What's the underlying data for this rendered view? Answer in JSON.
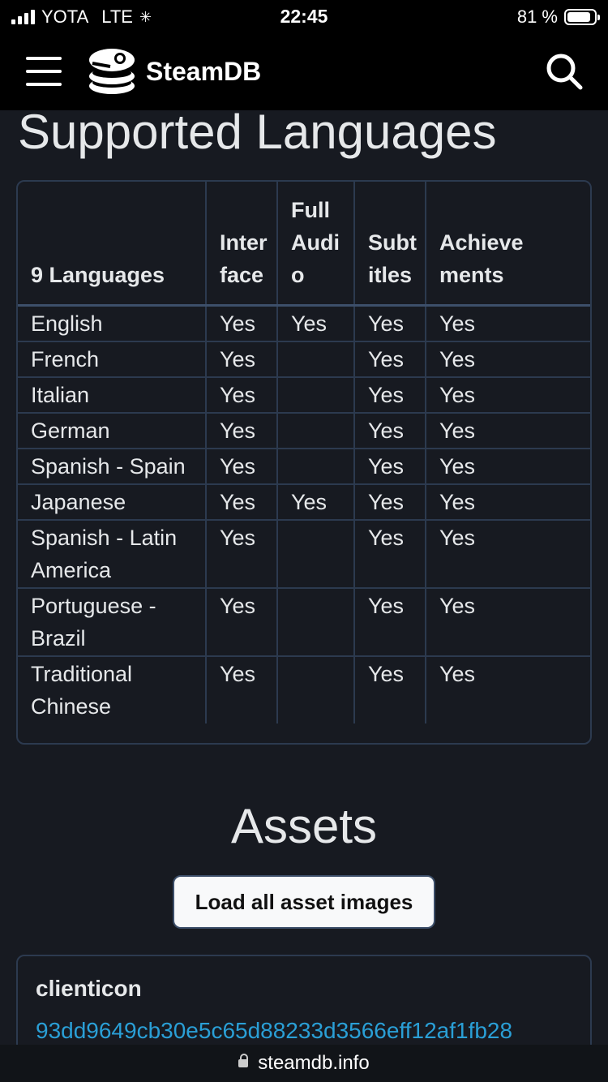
{
  "status_bar": {
    "carrier": "YOTA",
    "network": "LTE",
    "time": "22:45",
    "battery": "81 %"
  },
  "navbar": {
    "brand": "SteamDB"
  },
  "languages": {
    "title": "Supported Languages",
    "headers": [
      "9 Languages",
      "Inter face",
      "Full Audi o",
      "Subt itles",
      "Achieve ments"
    ],
    "rows": [
      {
        "lang": "English",
        "interface": "Yes",
        "audio": "Yes",
        "subtitles": "Yes",
        "achievements": "Yes"
      },
      {
        "lang": "French",
        "interface": "Yes",
        "audio": "",
        "subtitles": "Yes",
        "achievements": "Yes"
      },
      {
        "lang": "Italian",
        "interface": "Yes",
        "audio": "",
        "subtitles": "Yes",
        "achievements": "Yes"
      },
      {
        "lang": "German",
        "interface": "Yes",
        "audio": "",
        "subtitles": "Yes",
        "achievements": "Yes"
      },
      {
        "lang": "Spanish - Spain",
        "interface": "Yes",
        "audio": "",
        "subtitles": "Yes",
        "achievements": "Yes"
      },
      {
        "lang": "Japanese",
        "interface": "Yes",
        "audio": "Yes",
        "subtitles": "Yes",
        "achievements": "Yes"
      },
      {
        "lang": "Spanish - Latin America",
        "interface": "Yes",
        "audio": "",
        "subtitles": "Yes",
        "achievements": "Yes"
      },
      {
        "lang": "Portuguese - Brazil",
        "interface": "Yes",
        "audio": "",
        "subtitles": "Yes",
        "achievements": "Yes"
      },
      {
        "lang": "Traditional Chinese",
        "interface": "Yes",
        "audio": "",
        "subtitles": "Yes",
        "achievements": "Yes"
      }
    ]
  },
  "assets": {
    "title": "Assets",
    "load_button": "Load all asset images",
    "card": {
      "name": "clienticon",
      "hash": "93dd9649cb30e5c65d88233d3566eff12af1fb28"
    }
  },
  "url_bar": {
    "domain": "steamdb.info"
  },
  "colors": {
    "background": "#171a21",
    "link": "#2a9fd6",
    "border": "#2c3a4f"
  }
}
